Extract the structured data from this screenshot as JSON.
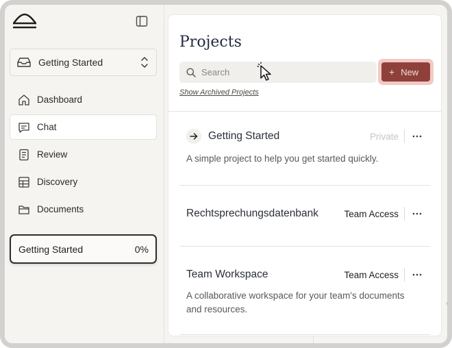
{
  "sidebar": {
    "workspace": {
      "label": "Getting Started"
    },
    "items": [
      {
        "label": "Dashboard",
        "icon": "home-icon",
        "active": false
      },
      {
        "label": "Chat",
        "icon": "chat-icon",
        "active": true
      },
      {
        "label": "Review",
        "icon": "review-icon",
        "active": false
      },
      {
        "label": "Discovery",
        "icon": "table-icon",
        "active": false
      },
      {
        "label": "Documents",
        "icon": "folder-icon",
        "active": false
      }
    ],
    "progress": {
      "label": "Getting Started",
      "value": "0%"
    }
  },
  "main": {
    "title": "Projects",
    "search": {
      "placeholder": "Search",
      "value": ""
    },
    "new_button": {
      "label": "New"
    },
    "archived_link": "Show Archived Projects",
    "projects": [
      {
        "name": "Getting Started",
        "access": "Private",
        "description": "A simple project to help you get started quickly."
      },
      {
        "name": "Rechtsprechungsdatenbank",
        "access": "Team Access",
        "description": ""
      },
      {
        "name": "Team Workspace",
        "access": "Team Access",
        "description": "A collaborative workspace for your team's documents and resources."
      }
    ]
  },
  "background_fragment": "q",
  "colors": {
    "accent": "#8f403a",
    "accent_halo": "#f3c9c5",
    "sidebar_bg": "#f5f4f1",
    "title": "#1f2a3a"
  }
}
